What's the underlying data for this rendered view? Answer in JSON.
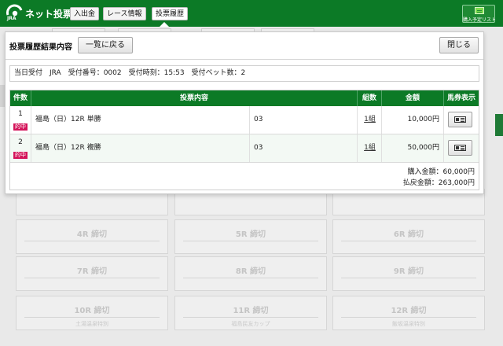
{
  "header": {
    "brand": "ネット投票",
    "brand_sub": "JRA",
    "nav": [
      "入出金",
      "レース情報",
      "投票履歴"
    ],
    "active_nav": 2,
    "cart_label": "購入予定リスト"
  },
  "background": {
    "races": [
      {
        "title": "4R 締切",
        "sub": ""
      },
      {
        "title": "5R 締切",
        "sub": ""
      },
      {
        "title": "6R 締切",
        "sub": ""
      },
      {
        "title": "7R 締切",
        "sub": ""
      },
      {
        "title": "8R 締切",
        "sub": ""
      },
      {
        "title": "9R 締切",
        "sub": ""
      },
      {
        "title": "10R 締切",
        "sub": "土湯温泉特別"
      },
      {
        "title": "11R 締切",
        "sub": "福島民友カップ"
      },
      {
        "title": "12R 締切",
        "sub": "飯坂温泉特別"
      }
    ]
  },
  "modal": {
    "title": "投票履歴結果内容",
    "back_label": "一覧に戻る",
    "close_label": "閉じる",
    "receipt": "当日受付　JRA　受付番号：0002　受付時刻：15:53　受付ベット数：2",
    "columns": {
      "num": "件数",
      "content": "投票内容",
      "kumi": "組数",
      "amount": "金額",
      "horse": "馬券表示"
    },
    "rows": [
      {
        "num": "1",
        "hit": "的中",
        "bet": "福島（日）12R 単勝",
        "selection": "03",
        "kumi": "1組",
        "amount": "10,000円"
      },
      {
        "num": "2",
        "hit": "的中",
        "bet": "福島（日）12R 複勝",
        "selection": "03",
        "kumi": "1組",
        "amount": "50,000円"
      }
    ],
    "purchase_total": "購入金額：60,000円",
    "payout_total": "払戻金額：263,000円"
  },
  "colors": {
    "brand_green": "#0c7a26",
    "hit_badge": "#d4145a"
  }
}
